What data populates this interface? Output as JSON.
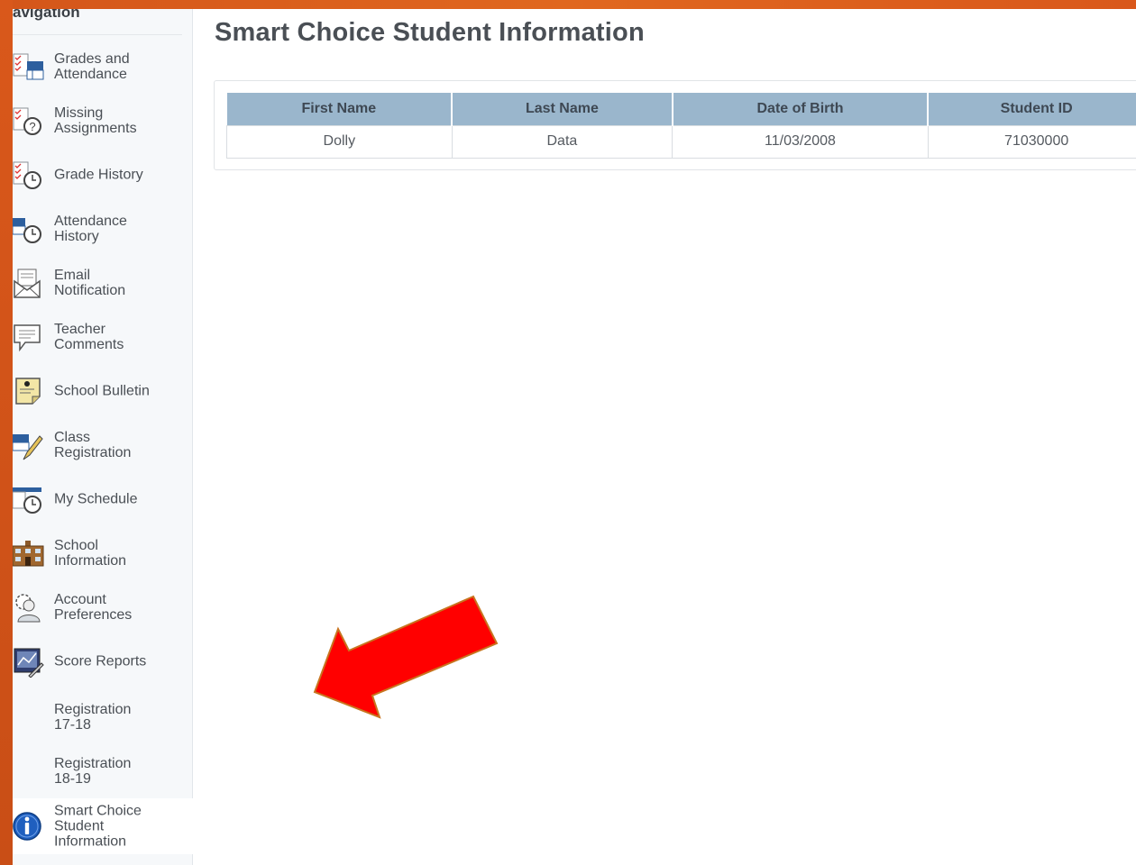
{
  "sidebar": {
    "header": "avigation",
    "items": [
      {
        "label": "Grades and\nAttendance",
        "icon": "grades-attendance-icon"
      },
      {
        "label": "Missing\nAssignments",
        "icon": "missing-assignments-icon"
      },
      {
        "label": "Grade History",
        "icon": "grade-history-icon"
      },
      {
        "label": "Attendance\nHistory",
        "icon": "attendance-history-icon"
      },
      {
        "label": "Email\nNotification",
        "icon": "email-notification-icon"
      },
      {
        "label": "Teacher\nComments",
        "icon": "teacher-comments-icon"
      },
      {
        "label": "School Bulletin",
        "icon": "school-bulletin-icon"
      },
      {
        "label": "Class\nRegistration",
        "icon": "class-registration-icon"
      },
      {
        "label": "My Schedule",
        "icon": "my-schedule-icon"
      },
      {
        "label": "School\nInformation",
        "icon": "school-information-icon"
      },
      {
        "label": "Account\nPreferences",
        "icon": "account-preferences-icon"
      },
      {
        "label": "Score Reports",
        "icon": "score-reports-icon"
      },
      {
        "label": "Registration\n17-18",
        "icon": ""
      },
      {
        "label": "Registration\n18-19",
        "icon": ""
      },
      {
        "label": "Smart Choice\nStudent\nInformation",
        "icon": "info-icon",
        "active": true
      }
    ]
  },
  "main": {
    "title": "Smart Choice Student Information",
    "table": {
      "headers": [
        "First Name",
        "Last Name",
        "Date of Birth",
        "Student ID"
      ],
      "rows": [
        [
          "Dolly",
          "Data",
          "11/03/2008",
          "71030000"
        ]
      ]
    }
  },
  "colors": {
    "frame": "#d9581b",
    "header_bg": "#9ab6cc",
    "arrow": "#ff0000"
  }
}
